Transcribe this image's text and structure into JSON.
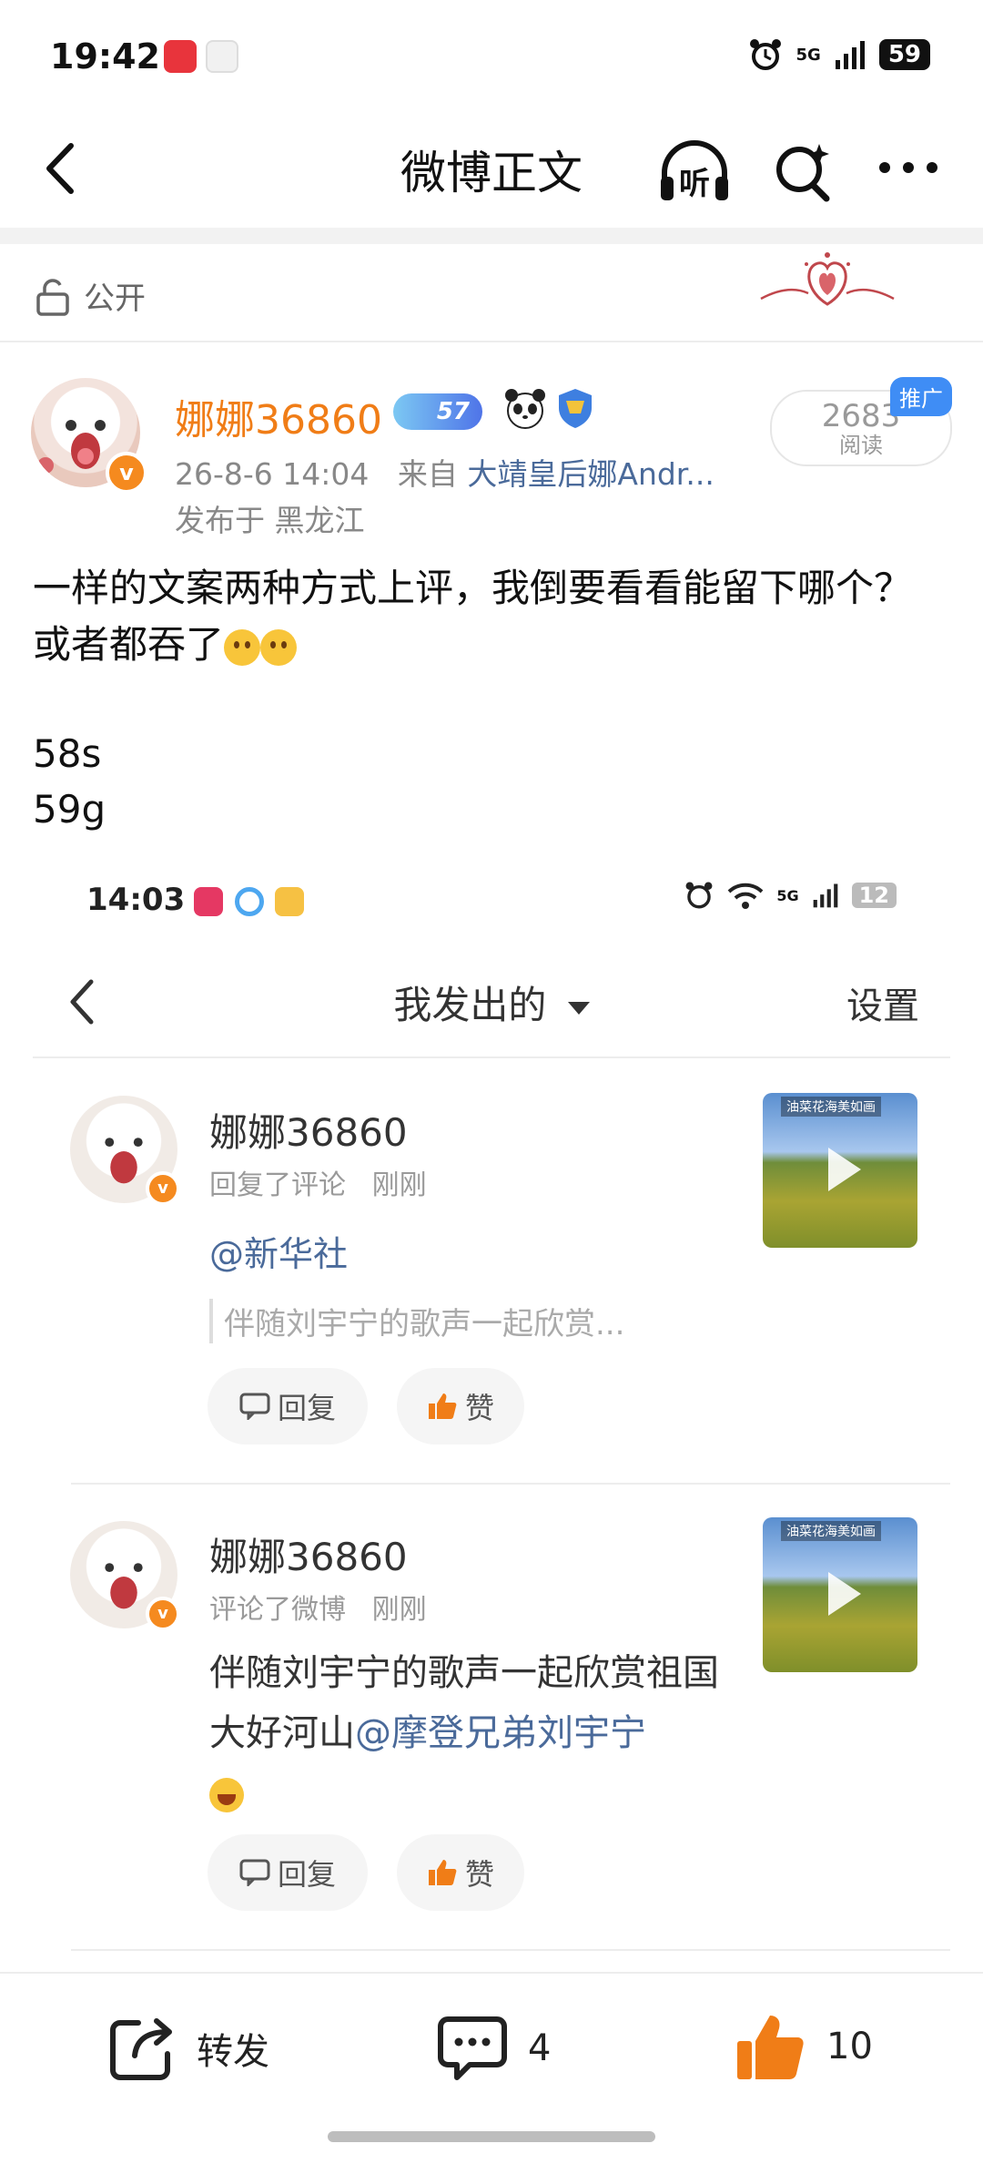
{
  "status_bar": {
    "time": "19:42",
    "network": "5G",
    "battery": "59"
  },
  "nav": {
    "title": "微博正文",
    "listen_label": "听"
  },
  "visibility": {
    "label": "公开"
  },
  "post": {
    "author": "娜娜36860",
    "level_badge": "57",
    "date": "26-8-6 14:04",
    "from_prefix": "来自",
    "source": "大靖皇后娜Andr...",
    "location": "发布于 黑龙江",
    "read_count": "2683",
    "read_label": "阅读",
    "promo_label": "推广",
    "text": "一样的文案两种方式上评，我倒要看看能留下哪个？或者都吞了",
    "line2": "58s",
    "line3": "59g"
  },
  "embedded": {
    "status_time": "14:03",
    "status_network": "5G",
    "status_battery": "12",
    "nav_title": "我发出的",
    "settings_label": "设置",
    "cards": [
      {
        "name": "娜娜36860",
        "action": "回复了评论",
        "time": "刚刚",
        "mention": "@新华社",
        "quote": "伴随刘宇宁的歌声一起欣赏...",
        "thumb_caption": "油菜花海美如画",
        "reply_label": "回复",
        "like_label": "赞"
      },
      {
        "name": "娜娜36860",
        "action": "评论了微博",
        "time": "刚刚",
        "body": "伴随刘宇宁的歌声一起欣赏祖国大好河山",
        "body_at": "@摩登兄弟刘宇宁",
        "thumb_caption": "油菜花海美如画",
        "reply_label": "回复",
        "like_label": "赞"
      }
    ]
  },
  "bottom_bar": {
    "repost_label": "转发",
    "comment_count": "4",
    "like_count": "10"
  },
  "colors": {
    "username": "#f07d17",
    "link": "#4a6a9a",
    "like": "#f07d17",
    "promo": "#3f8df5"
  }
}
